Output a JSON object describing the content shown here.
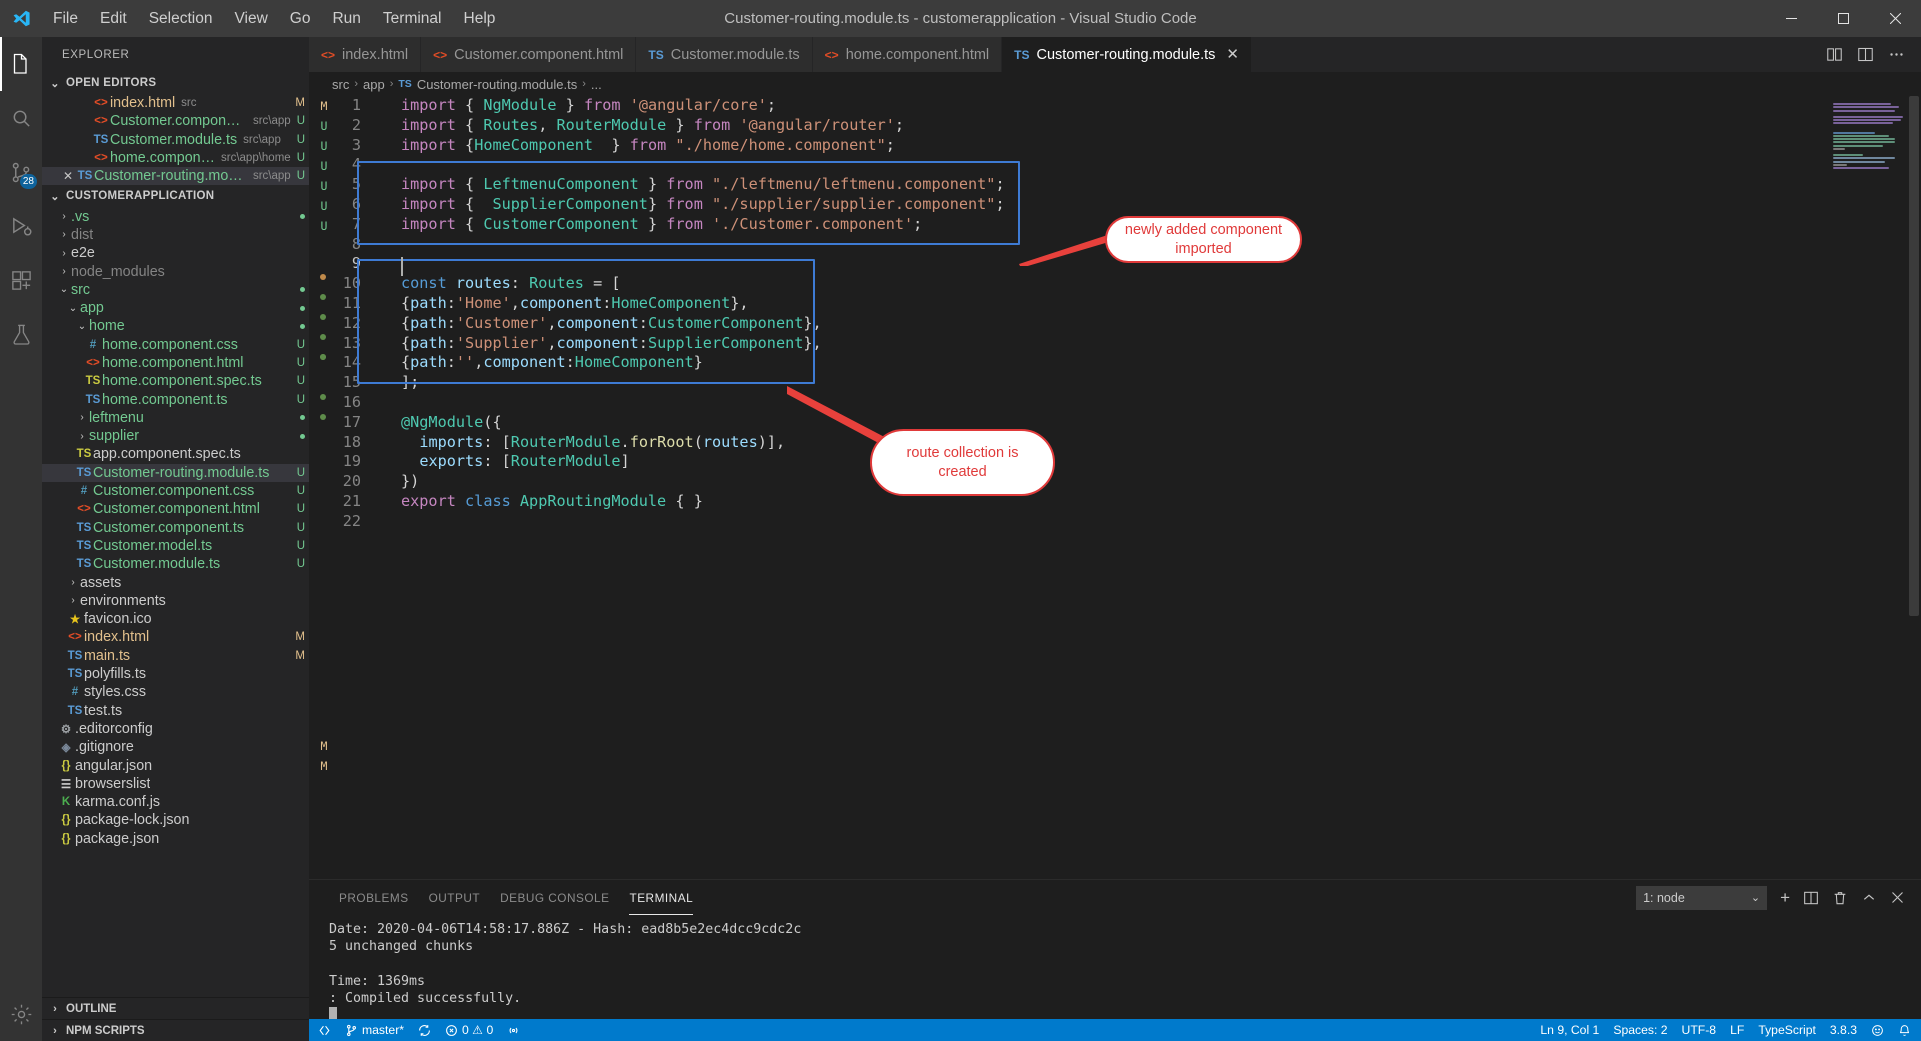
{
  "window": {
    "title": "Customer-routing.module.ts - customerapplication - Visual Studio Code",
    "app_icon": "vscode-logo-icon",
    "minimize": "—",
    "maximize": "▢",
    "close": "✕"
  },
  "menubar": {
    "items": [
      "File",
      "Edit",
      "Selection",
      "View",
      "Go",
      "Run",
      "Terminal",
      "Help"
    ]
  },
  "activitybar": {
    "items": [
      {
        "name": "explorer",
        "icon": "files-icon",
        "badge": ""
      },
      {
        "name": "search",
        "icon": "search-icon",
        "badge": ""
      },
      {
        "name": "source-control",
        "icon": "source-control-icon",
        "badge": "28"
      },
      {
        "name": "run-and-debug",
        "icon": "run-debug-icon",
        "badge": ""
      },
      {
        "name": "extensions",
        "icon": "extensions-icon",
        "badge": ""
      },
      {
        "name": "test",
        "icon": "beaker-icon",
        "badge": ""
      }
    ],
    "bottom": [
      {
        "name": "manage",
        "icon": "gear-icon"
      }
    ]
  },
  "sidebar": {
    "title": "EXPLORER",
    "open_editors": {
      "label": "OPEN EDITORS",
      "expanded": true,
      "items": [
        {
          "name": "index.html",
          "path": "src",
          "icon": "html-icon",
          "status": "M",
          "name_color": "mod",
          "closable": false
        },
        {
          "name": "Customer.component.html",
          "path": "src\\app",
          "icon": "html-icon",
          "status": "U",
          "name_color": "new",
          "closable": false
        },
        {
          "name": "Customer.module.ts",
          "path": "src\\app",
          "icon": "ts-icon",
          "status": "U",
          "name_color": "new",
          "closable": false
        },
        {
          "name": "home.component.html",
          "path": "src\\app\\home",
          "icon": "html-icon",
          "status": "U",
          "name_color": "new",
          "closable": false
        },
        {
          "name": "Customer-routing.module.ts",
          "path": "src\\app",
          "icon": "ts-icon",
          "status": "U",
          "name_color": "new",
          "closable": true,
          "selected": true
        }
      ]
    },
    "workspace": {
      "label": "CUSTOMERAPPLICATION",
      "expanded": true,
      "items": [
        {
          "name": ".vs",
          "type": "folder",
          "indent": 1,
          "expanded": false,
          "name_color": "new",
          "dot": "green"
        },
        {
          "name": "dist",
          "type": "folder",
          "indent": 1,
          "expanded": false,
          "name_color": "dim"
        },
        {
          "name": "e2e",
          "type": "folder",
          "indent": 1,
          "expanded": false,
          "name_color": "plain"
        },
        {
          "name": "node_modules",
          "type": "folder",
          "indent": 1,
          "expanded": false,
          "name_color": "dim"
        },
        {
          "name": "src",
          "type": "folder",
          "indent": 1,
          "expanded": true,
          "name_color": "new",
          "dot": "green"
        },
        {
          "name": "app",
          "type": "folder",
          "indent": 2,
          "expanded": true,
          "name_color": "new",
          "dot": "green"
        },
        {
          "name": "home",
          "type": "folder",
          "indent": 3,
          "expanded": true,
          "name_color": "new",
          "dot": "green"
        },
        {
          "name": "home.component.css",
          "type": "file",
          "indent": 4,
          "icon": "css-icon",
          "name_color": "new",
          "status": "U"
        },
        {
          "name": "home.component.html",
          "type": "file",
          "indent": 4,
          "icon": "html-icon",
          "name_color": "new",
          "status": "U"
        },
        {
          "name": "home.component.spec.ts",
          "type": "file",
          "indent": 4,
          "icon": "ts-spec-icon",
          "name_color": "new",
          "status": "U"
        },
        {
          "name": "home.component.ts",
          "type": "file",
          "indent": 4,
          "icon": "ts-icon",
          "name_color": "new",
          "status": "U"
        },
        {
          "name": "leftmenu",
          "type": "folder",
          "indent": 3,
          "expanded": false,
          "name_color": "new",
          "dot": "green"
        },
        {
          "name": "supplier",
          "type": "folder",
          "indent": 3,
          "expanded": false,
          "name_color": "new",
          "dot": "green"
        },
        {
          "name": "app.component.spec.ts",
          "type": "file",
          "indent": 3,
          "icon": "ts-spec-icon",
          "name_color": "plain"
        },
        {
          "name": "Customer-routing.module.ts",
          "type": "file",
          "indent": 3,
          "icon": "ts-icon",
          "name_color": "new",
          "status": "U",
          "selected": true
        },
        {
          "name": "Customer.component.css",
          "type": "file",
          "indent": 3,
          "icon": "css-icon",
          "name_color": "new",
          "status": "U"
        },
        {
          "name": "Customer.component.html",
          "type": "file",
          "indent": 3,
          "icon": "html-icon",
          "name_color": "new",
          "status": "U"
        },
        {
          "name": "Customer.component.ts",
          "type": "file",
          "indent": 3,
          "icon": "ts-icon",
          "name_color": "new",
          "status": "U"
        },
        {
          "name": "Customer.model.ts",
          "type": "file",
          "indent": 3,
          "icon": "ts-icon",
          "name_color": "new",
          "status": "U"
        },
        {
          "name": "Customer.module.ts",
          "type": "file",
          "indent": 3,
          "icon": "ts-icon",
          "name_color": "new",
          "status": "U"
        },
        {
          "name": "assets",
          "type": "folder",
          "indent": 2,
          "expanded": false,
          "name_color": "plain"
        },
        {
          "name": "environments",
          "type": "folder",
          "indent": 2,
          "expanded": false,
          "name_color": "plain"
        },
        {
          "name": "favicon.ico",
          "type": "file",
          "indent": 2,
          "icon": "star-icon",
          "name_color": "plain"
        },
        {
          "name": "index.html",
          "type": "file",
          "indent": 2,
          "icon": "html-icon",
          "name_color": "mod",
          "status": "M"
        },
        {
          "name": "main.ts",
          "type": "file",
          "indent": 2,
          "icon": "ts-icon",
          "name_color": "mod",
          "status": "M"
        },
        {
          "name": "polyfills.ts",
          "type": "file",
          "indent": 2,
          "icon": "ts-icon",
          "name_color": "plain"
        },
        {
          "name": "styles.css",
          "type": "file",
          "indent": 2,
          "icon": "css-icon",
          "name_color": "plain"
        },
        {
          "name": "test.ts",
          "type": "file",
          "indent": 2,
          "icon": "ts-icon",
          "name_color": "plain"
        },
        {
          "name": ".editorconfig",
          "type": "file",
          "indent": 1,
          "icon": "gear-icon",
          "name_color": "plain"
        },
        {
          "name": ".gitignore",
          "type": "file",
          "indent": 1,
          "icon": "git-icon",
          "name_color": "plain"
        },
        {
          "name": "angular.json",
          "type": "file",
          "indent": 1,
          "icon": "json-icon",
          "name_color": "plain"
        },
        {
          "name": "browserslist",
          "type": "file",
          "indent": 1,
          "icon": "list-icon",
          "name_color": "plain"
        },
        {
          "name": "karma.conf.js",
          "type": "file",
          "indent": 1,
          "icon": "karma-icon",
          "name_color": "plain"
        },
        {
          "name": "package-lock.json",
          "type": "file",
          "indent": 1,
          "icon": "json-icon",
          "name_color": "plain"
        },
        {
          "name": "package.json",
          "type": "file",
          "indent": 1,
          "icon": "json-icon",
          "name_color": "plain"
        }
      ]
    },
    "outline": {
      "label": "OUTLINE",
      "expanded": false
    },
    "npm_scripts": {
      "label": "NPM SCRIPTS",
      "expanded": false
    }
  },
  "tabs": [
    {
      "label": "index.html",
      "icon": "html-icon",
      "active": false
    },
    {
      "label": "Customer.component.html",
      "icon": "html-icon",
      "active": false
    },
    {
      "label": "Customer.module.ts",
      "icon": "ts-icon",
      "active": false
    },
    {
      "label": "home.component.html",
      "icon": "html-icon",
      "active": false
    },
    {
      "label": "Customer-routing.module.ts",
      "icon": "ts-icon",
      "active": true,
      "close": "✕"
    }
  ],
  "tab_actions": [
    {
      "name": "split-editor-icon"
    },
    {
      "name": "open-changes-icon"
    },
    {
      "name": "more-actions-icon"
    }
  ],
  "breadcrumb": [
    "src",
    "app",
    "Customer-routing.module.ts",
    "..."
  ],
  "editor": {
    "language": "TypeScript",
    "lines": [
      {
        "n": 1,
        "text": "import { NgModule } from '@angular/core';"
      },
      {
        "n": 2,
        "text": "import { Routes, RouterModule } from '@angular/router';"
      },
      {
        "n": 3,
        "text": "import {HomeComponent  } from \"./home/home.component\";"
      },
      {
        "n": 4,
        "text": ""
      },
      {
        "n": 5,
        "text": "import { LeftmenuComponent } from \"./leftmenu/leftmenu.component\";"
      },
      {
        "n": 6,
        "text": "import {  SupplierComponent} from \"./supplier/supplier.component\";"
      },
      {
        "n": 7,
        "text": "import { CustomerComponent } from './Customer.component';"
      },
      {
        "n": 8,
        "text": ""
      },
      {
        "n": 9,
        "text": ""
      },
      {
        "n": 10,
        "text": "const routes: Routes = ["
      },
      {
        "n": 11,
        "text": "{path:'Home',component:HomeComponent},"
      },
      {
        "n": 12,
        "text": "{path:'Customer',component:CustomerComponent},"
      },
      {
        "n": 13,
        "text": "{path:'Supplier',component:SupplierComponent},"
      },
      {
        "n": 14,
        "text": "{path:'',component:HomeComponent}"
      },
      {
        "n": 15,
        "text": "];"
      },
      {
        "n": 16,
        "text": ""
      },
      {
        "n": 17,
        "text": "@NgModule({"
      },
      {
        "n": 18,
        "text": "  imports: [RouterModule.forRoot(routes)],"
      },
      {
        "n": 19,
        "text": "  exports: [RouterModule]"
      },
      {
        "n": 20,
        "text": "})"
      },
      {
        "n": 21,
        "text": "export class AppRoutingModule { }"
      },
      {
        "n": 22,
        "text": ""
      }
    ],
    "cursor_line": 9
  },
  "annotations": [
    {
      "name": "imports-callout",
      "text": "newly added component imported"
    },
    {
      "name": "routes-callout",
      "text": "route collection is created"
    }
  ],
  "panel": {
    "tabs": [
      {
        "label": "PROBLEMS",
        "active": false
      },
      {
        "label": "OUTPUT",
        "active": false
      },
      {
        "label": "DEBUG CONSOLE",
        "active": false
      },
      {
        "label": "TERMINAL",
        "active": true
      }
    ],
    "terminal_selector": {
      "value": "1: node",
      "chevron": "⌄"
    },
    "actions": [
      {
        "name": "new-terminal-icon",
        "glyph": "+"
      },
      {
        "name": "split-terminal-icon"
      },
      {
        "name": "kill-terminal-icon"
      },
      {
        "name": "maximize-panel-icon",
        "glyph": "⌃"
      },
      {
        "name": "close-panel-icon",
        "glyph": "✕"
      }
    ],
    "terminal_output": [
      "Date: 2020-04-06T14:58:17.886Z - Hash: ead8b5e2ec4dcc9cdc2c",
      "5 unchanged chunks",
      "",
      "Time: 1369ms",
      ": Compiled successfully."
    ]
  },
  "statusbar": {
    "left": [
      {
        "name": "remote-icon",
        "label": ""
      },
      {
        "name": "branch",
        "label": "master*",
        "icon": "git-branch-icon"
      },
      {
        "name": "sync",
        "label": "",
        "icon": "sync-icon"
      },
      {
        "name": "problems",
        "label": "0 ⚠ 0",
        "icon": "error-icon"
      },
      {
        "name": "ports",
        "label": "",
        "icon": "radio-tower-icon"
      }
    ],
    "right": [
      {
        "name": "cursor-position",
        "label": "Ln 9, Col 1"
      },
      {
        "name": "indentation",
        "label": "Spaces: 2"
      },
      {
        "name": "encoding",
        "label": "UTF-8"
      },
      {
        "name": "eol",
        "label": "LF"
      },
      {
        "name": "language-mode",
        "label": "TypeScript"
      },
      {
        "name": "ts-version",
        "label": "3.8.3"
      },
      {
        "name": "feedback",
        "label": "",
        "icon": "smiley-icon"
      },
      {
        "name": "notifications",
        "label": "",
        "icon": "bell-icon"
      }
    ]
  },
  "colors": {
    "accent": "#007acc",
    "titlebar_bg": "#3c3c3c",
    "sidebar_bg": "#252526",
    "editor_bg": "#1e1e1e",
    "highlight_box": "#3e7bd4",
    "callout_red": "#e03a3a",
    "modified": "#e2c08d",
    "untracked": "#73c991"
  }
}
